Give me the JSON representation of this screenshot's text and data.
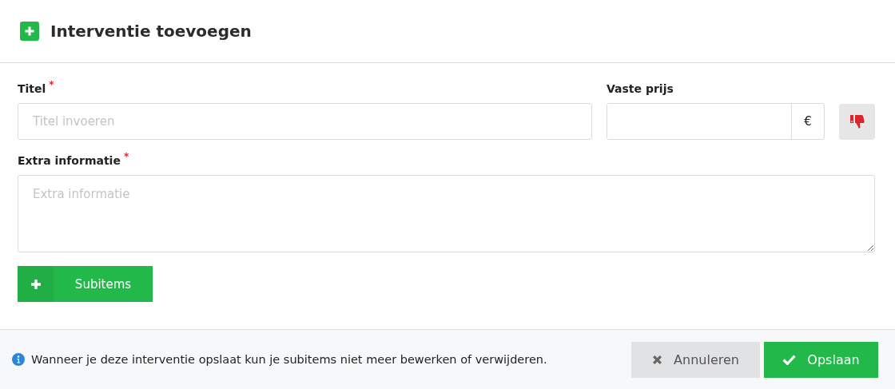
{
  "header": {
    "title": "Interventie toevoegen"
  },
  "fields": {
    "title": {
      "label": "Titel",
      "required_mark": "*",
      "placeholder": "Titel invoeren"
    },
    "price": {
      "label": "Vaste prijs",
      "addon": "€"
    },
    "info": {
      "label": "Extra informatie",
      "required_mark": "*",
      "placeholder": "Extra informatie"
    }
  },
  "subitems_button": {
    "label": "Subitems"
  },
  "footer": {
    "notice": "Wanneer je deze interventie opslaat kun je subitems niet meer bewerken of verwijderen.",
    "buttons": [
      {
        "kind": "cancel",
        "label": "Annuleren"
      },
      {
        "kind": "save",
        "label": "Opslaan"
      }
    ]
  }
}
